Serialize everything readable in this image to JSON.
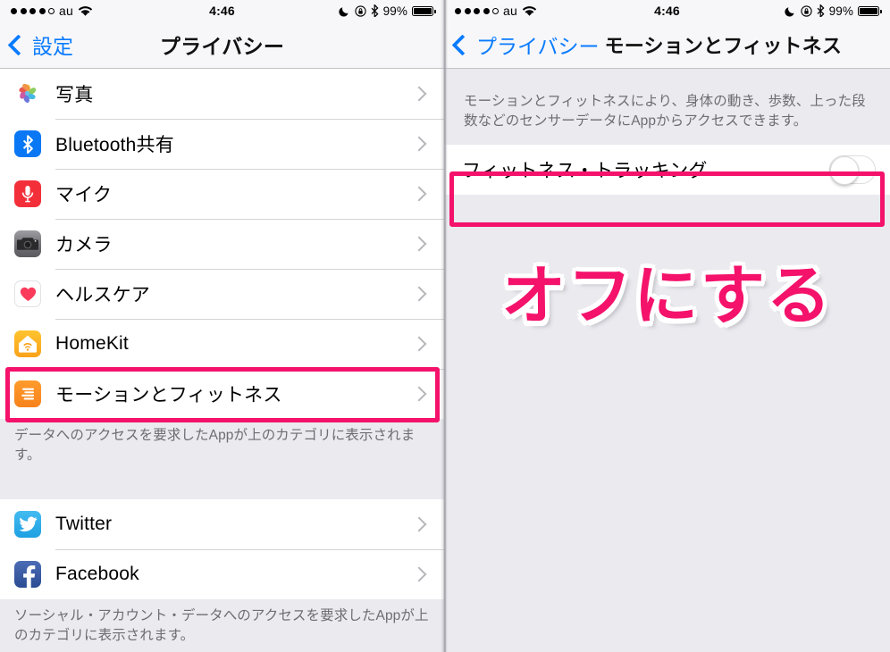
{
  "status_bar": {
    "signal_filled": 4,
    "signal_total": 5,
    "carrier": "au",
    "wifi_icon": "wifi-icon",
    "time": "4:46",
    "dnd_icon": "moon-icon",
    "rotation_lock_icon": "rotation-lock-icon",
    "bluetooth_icon": "bluetooth-icon",
    "battery_percent": "99%"
  },
  "left_screen": {
    "nav": {
      "back_label": "設定",
      "title": "プライバシー"
    },
    "rows": [
      {
        "label": "写真",
        "icon": "photos-icon"
      },
      {
        "label": "Bluetooth共有",
        "icon": "bluetooth-icon"
      },
      {
        "label": "マイク",
        "icon": "microphone-icon"
      },
      {
        "label": "カメラ",
        "icon": "camera-icon"
      },
      {
        "label": "ヘルスケア",
        "icon": "health-icon"
      },
      {
        "label": "HomeKit",
        "icon": "homekit-icon"
      },
      {
        "label": "モーションとフィットネス",
        "icon": "motion-fitness-icon"
      }
    ],
    "footnote_1": "データへのアクセスを要求したAppが上のカテゴリに表示されます。",
    "social_rows": [
      {
        "label": "Twitter",
        "icon": "twitter-icon"
      },
      {
        "label": "Facebook",
        "icon": "facebook-icon"
      }
    ],
    "footnote_2": "ソーシャル・アカウント・データへのアクセスを要求したAppが上のカテゴリに表示されます。"
  },
  "right_screen": {
    "nav": {
      "back_label": "プライバシー",
      "title": "モーションとフィットネス"
    },
    "description": "モーションとフィットネスにより、身体の動き、歩数、上った段数などのセンサーデータにAppからアクセスできます。",
    "switch_label": "フィットネス・トラッキング",
    "switch_state": "off",
    "annotation_text": "オフにする"
  },
  "colors": {
    "highlight_pink": "#f4126b",
    "ios_blue": "#0a7bff",
    "page_background": "#eaeaef",
    "cell_background": "#ffffff"
  }
}
